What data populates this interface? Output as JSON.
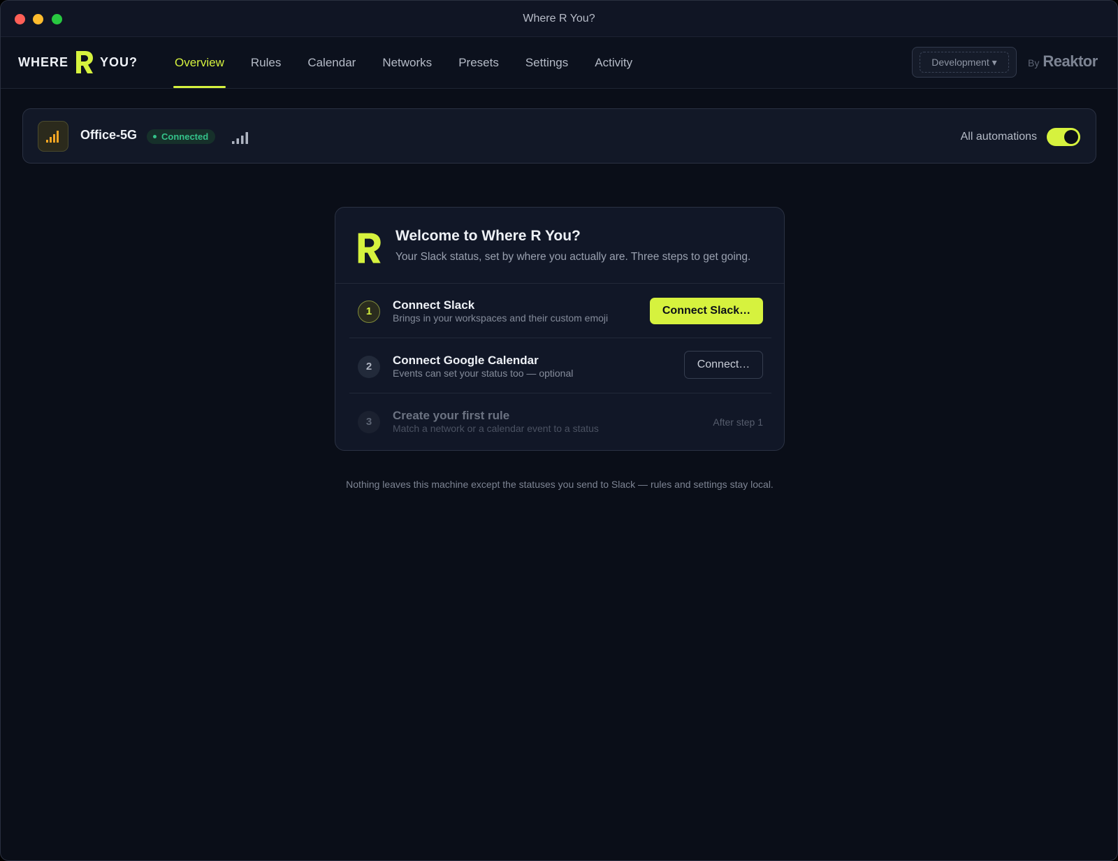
{
  "window": {
    "title": "Where R You?"
  },
  "brand": {
    "word_left": "WHERE",
    "word_right": "YOU?",
    "accent_color": "#d6f23e"
  },
  "nav": {
    "tabs": [
      {
        "label": "Overview",
        "active": true
      },
      {
        "label": "Rules",
        "active": false
      },
      {
        "label": "Calendar",
        "active": false
      },
      {
        "label": "Networks",
        "active": false
      },
      {
        "label": "Presets",
        "active": false
      },
      {
        "label": "Settings",
        "active": false
      },
      {
        "label": "Activity",
        "active": false
      }
    ],
    "environment_label": "Development ▾",
    "by_label": "By",
    "maker_name": "Reaktor"
  },
  "status": {
    "wifi_icon": "wifi-icon",
    "network_name": "Office-5G",
    "connection_badge": "Connected",
    "badge_color": "#34c28a",
    "signal_icon": "signal-bars-icon",
    "automations_label": "All automations",
    "automations_enabled": true
  },
  "welcome": {
    "title": "Welcome to Where R You?",
    "subtitle": "Your Slack status, set by where you actually are. Three steps to get going.",
    "steps": [
      {
        "number": "1",
        "title": "Connect Slack",
        "description": "Brings in your workspaces and their custom emoji",
        "action_label": "Connect Slack…"
      },
      {
        "number": "2",
        "title": "Connect Google Calendar",
        "description": "Events can set your status too — optional",
        "action_label": "Connect…"
      },
      {
        "number": "3",
        "title": "Create your first rule",
        "description": "Match a network or a calendar event to a status",
        "hint": "After step 1"
      }
    ]
  },
  "footnote": "Nothing leaves this machine except the statuses you send to Slack — rules and settings stay local."
}
